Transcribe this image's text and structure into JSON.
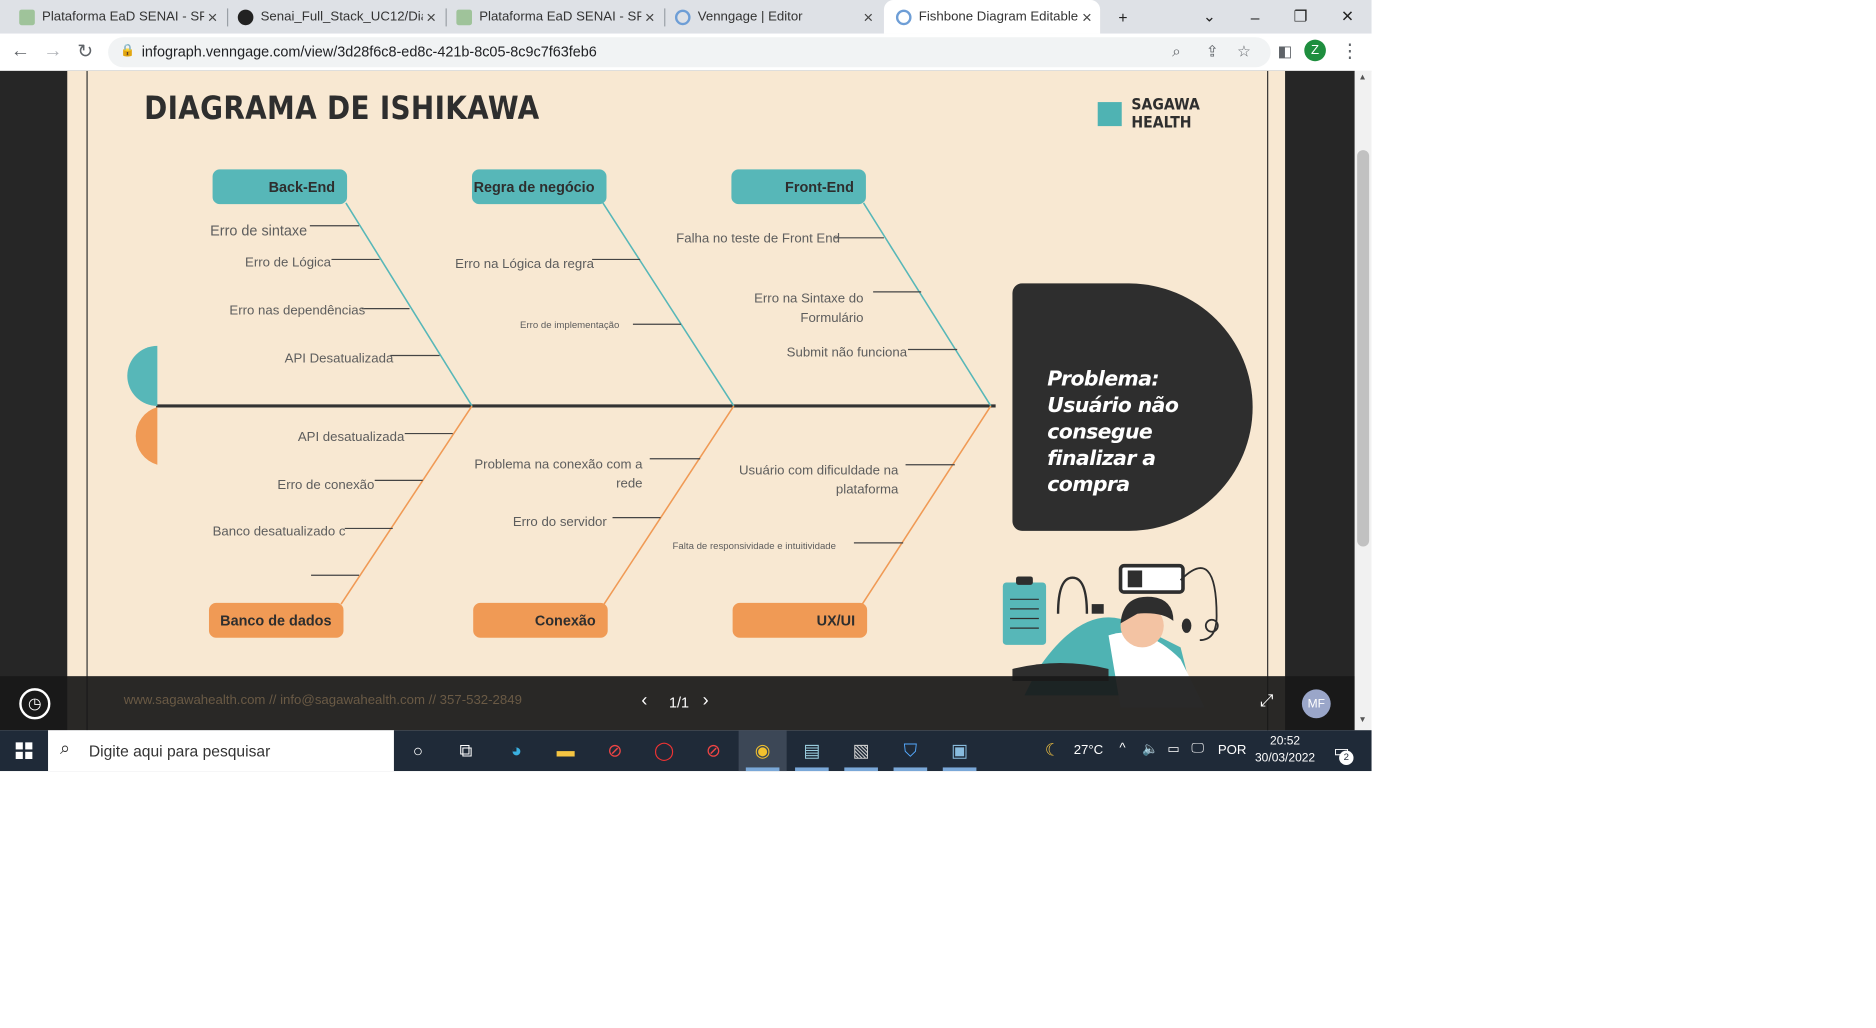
{
  "browser": {
    "tabs": [
      {
        "title": "Plataforma EaD SENAI - SP -",
        "favicon": "senai-icon"
      },
      {
        "title": "Senai_Full_Stack_UC12/Diagr",
        "favicon": "github-icon"
      },
      {
        "title": "Plataforma EaD SENAI - SP -",
        "favicon": "senai-icon"
      },
      {
        "title": "Venngage | Editor",
        "favicon": "venngage-icon"
      },
      {
        "title": "Fishbone Diagram Editable T",
        "favicon": "venngage-icon"
      }
    ],
    "url": "infograph.venngage.com/view/3d28f6c8-ed8c-421b-8c05-8c9c7f63feb6",
    "profile_initial": "Z"
  },
  "diagram": {
    "title": "DIAGRAMA DE ISHIKAWA",
    "brand": "SAGAWA HEALTH",
    "problem": "Problema: Usuário não consegue finalizar a compra",
    "categories_top": [
      {
        "label": "Back-End",
        "causes": [
          "Erro de sintaxe",
          "Erro de Lógica",
          "Erro nas dependências",
          "API Desatualizada"
        ]
      },
      {
        "label": "Regra de negócio",
        "causes": [
          "Erro na Lógica da regra",
          "Erro de implementação"
        ]
      },
      {
        "label": "Front-End",
        "causes": [
          "Falha no teste de Front End",
          "Erro na Sintaxe do Formulário",
          "Submit não funciona"
        ]
      }
    ],
    "categories_bottom": [
      {
        "label": "Banco de dados",
        "causes": [
          "API desatualizada",
          "Erro de conexão",
          "Banco desatualizado c"
        ]
      },
      {
        "label": "Conexão",
        "causes": [
          "Problema na conexão  com a rede",
          "Erro do servidor"
        ]
      },
      {
        "label": "UX/UI",
        "causes": [
          "Usuário com dificuldade na plataforma",
          "Falta de responsividade  e intuitividade"
        ]
      }
    ],
    "footer": "www.sagawahealth.com // info@sagawahealth.com // 357-532-2849",
    "colors": {
      "teal": "#57b7b8",
      "orange": "#f09a55",
      "dark": "#2e2e2e",
      "background": "#f8e8d2"
    }
  },
  "viewer": {
    "page_indicator": "1/1",
    "user_initials": "MF"
  },
  "taskbar": {
    "search_placeholder": "Digite aqui para pesquisar",
    "weather": "27°C",
    "language": "POR",
    "time": "20:52",
    "date": "30/03/2022",
    "notifications": "2"
  }
}
